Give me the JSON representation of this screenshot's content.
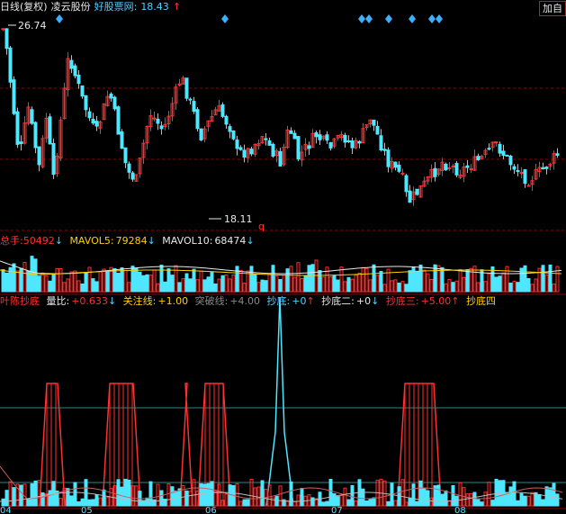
{
  "header": {
    "period": "日线(复权)",
    "stock_name": "凌云股份",
    "source": "好股票网:",
    "price": "18.43",
    "arrow": "↑",
    "add_button": "加自"
  },
  "price_chart": {
    "high_label": "26.74",
    "low_label": "18.11",
    "q_marker": "q"
  },
  "volume_panel": {
    "name": "总手:",
    "value": "50492",
    "ma5_label": "MAVOL5:",
    "ma5_value": "79284",
    "ma10_label": "MAVOL10:",
    "ma10_value": "68474",
    "down_arrow": "↓"
  },
  "indicator_panel": {
    "name": "叶陈抄底",
    "liangbi_label": "量比:",
    "liangbi_value": "+0.633",
    "guanzhu_label": "关注线:",
    "guanzhu_value": "+1.00",
    "tupo_label": "突破线:",
    "tupo_value": "+4.00",
    "chaodi_label": "抄底:",
    "chaodi_value": "+0",
    "chaodi2_label": "抄底二:",
    "chaodi2_value": "+0",
    "chaodi3_label": "抄底三:",
    "chaodi3_value": "+5.00",
    "chaodi4_label": "抄底四",
    "up_arrow": "↑",
    "down_arrow": "↓"
  },
  "x_axis": {
    "months": [
      "04",
      "05",
      "06",
      "07",
      "08"
    ]
  },
  "colors": {
    "up": "#ff3030",
    "down": "#4fe6ff",
    "grid": "#8b0000",
    "ma_white": "#e8e8e8",
    "ma_yellow": "#ffd000",
    "diamond": "#3ab0ff"
  }
}
